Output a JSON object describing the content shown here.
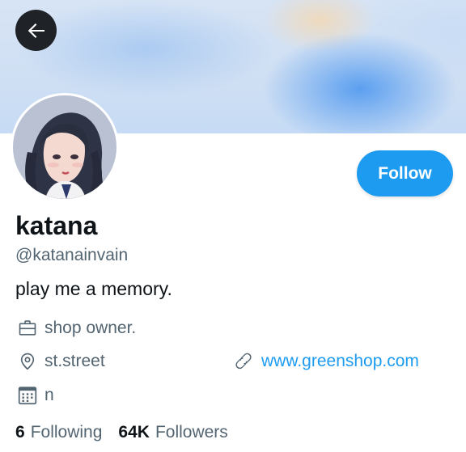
{
  "profile": {
    "name": "katana",
    "handle": "@katanainvain",
    "bio": "play me a memory.",
    "profession": "shop owner.",
    "location": "st.street",
    "website": "www.greenshop.com",
    "joined": "n"
  },
  "actions": {
    "follow_label": "Follow",
    "back_icon": "arrow-left-icon"
  },
  "stats": {
    "following_count": "6",
    "following_label": "Following",
    "followers_count": "64K",
    "followers_label": "Followers"
  },
  "icons": {
    "profession": "briefcase-icon",
    "location": "location-pin-icon",
    "website": "link-icon",
    "joined": "calendar-icon"
  },
  "colors": {
    "accent": "#1d9bf0",
    "text_primary": "#0f1419",
    "text_secondary": "#536471",
    "back_button_bg": "#1f2327"
  }
}
